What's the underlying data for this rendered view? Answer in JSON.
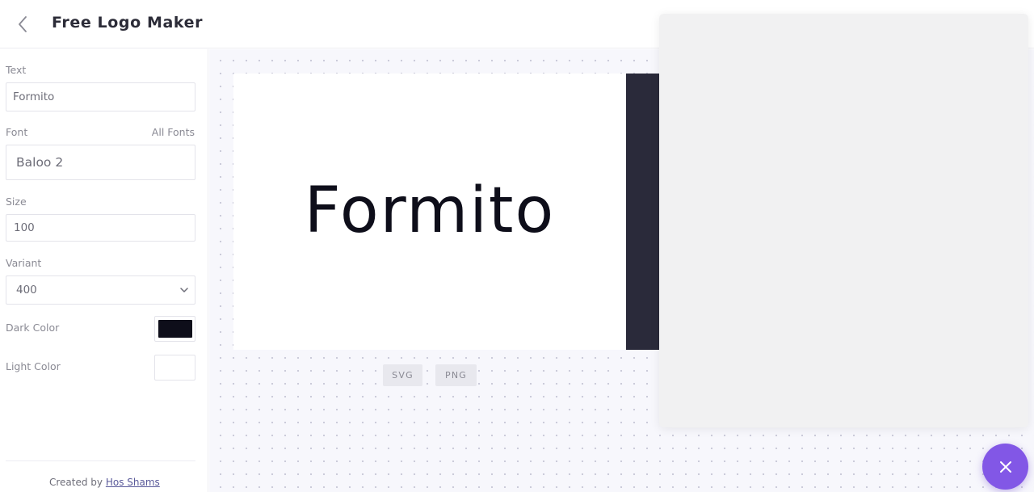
{
  "header": {
    "title": "Free Logo Maker",
    "back_icon": "chevron-left-icon"
  },
  "sidebar": {
    "text": {
      "label": "Text",
      "value": "Formito"
    },
    "font": {
      "label": "Font",
      "all_fonts_link": "All Fonts",
      "value": "Baloo 2"
    },
    "size": {
      "label": "Size",
      "value": "100"
    },
    "variant": {
      "label": "Variant",
      "value": "400",
      "icon": "chevron-down-icon"
    },
    "dark_color": {
      "label": "Dark Color",
      "value": "#0e0e1a"
    },
    "light_color": {
      "label": "Light Color",
      "value": "#ffffff"
    },
    "footer": {
      "prefix": "Created by",
      "author": "Hos Shams"
    }
  },
  "preview": {
    "logo_text": "Formito",
    "light_bg": "#ffffff",
    "dark_bg": "#2a2a3a",
    "buttons": {
      "svg": "SVG",
      "png": "PNG"
    }
  },
  "popup": {
    "background": "#f1f1f2"
  },
  "fab": {
    "icon": "close-icon",
    "color": "#8257e6"
  }
}
